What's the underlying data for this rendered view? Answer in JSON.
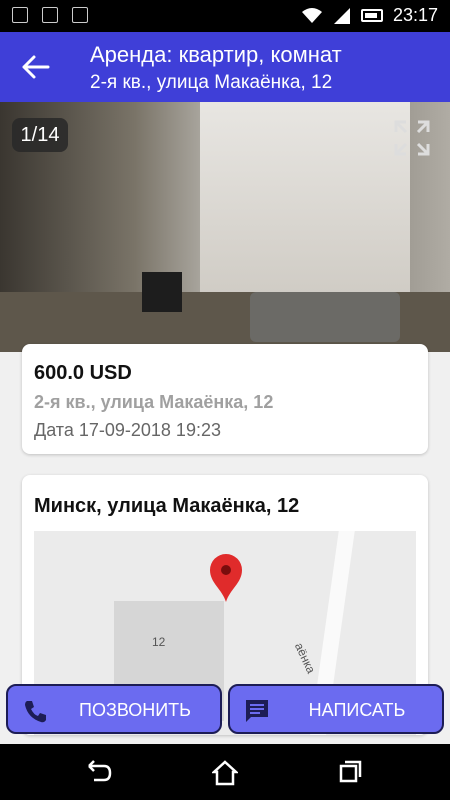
{
  "status_bar": {
    "time": "23:17"
  },
  "app_bar": {
    "title": "Аренда: квартир, комнат",
    "subtitle": "2-я кв., улица Макаёнка, 12",
    "accent_color": "#3f3fd8"
  },
  "gallery": {
    "counter": "1/14"
  },
  "listing": {
    "price": "600.0  USD",
    "address": "2-я кв., улица Макаёнка, 12",
    "date": "Дата  17-09-2018 19:23"
  },
  "map_card": {
    "title": "Минск, улица Макаёнка, 12",
    "building_number": "12",
    "road_label": "аёнка"
  },
  "actions": {
    "call_label": "ПОЗВОНИТЬ",
    "write_label": "НАПИСАТЬ",
    "button_color": "#6b6bf0"
  },
  "icons": [
    "back-arrow-icon",
    "fullscreen-icon",
    "map-pin-icon",
    "phone-icon",
    "message-icon",
    "nav-back-icon",
    "nav-home-icon",
    "nav-recents-icon",
    "wifi-icon",
    "signal-icon",
    "battery-icon"
  ]
}
